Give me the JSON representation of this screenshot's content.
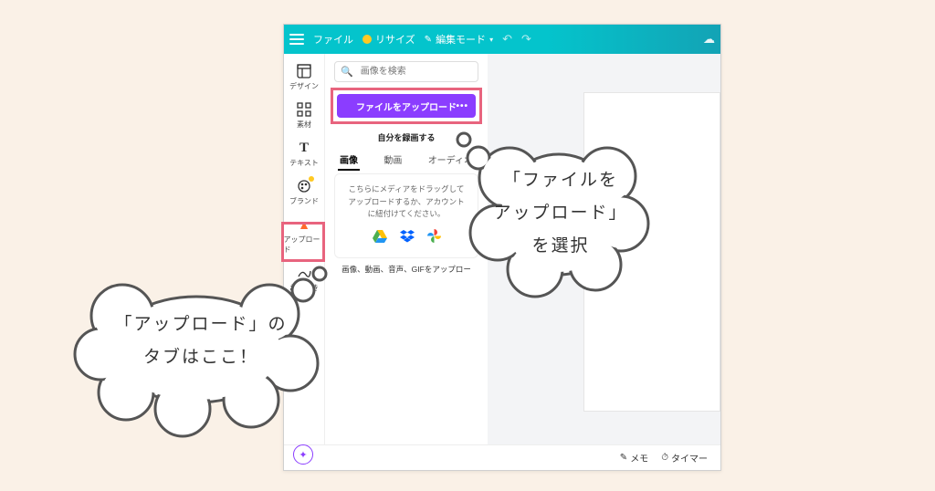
{
  "topbar": {
    "file_label": "ファイル",
    "resize_label": "リサイズ",
    "edit_mode_label": "編集モード"
  },
  "siderail": {
    "items": [
      {
        "label": "デザイン"
      },
      {
        "label": "素材"
      },
      {
        "label": "テキスト"
      },
      {
        "label": "ブランド"
      },
      {
        "label": "アップロード"
      },
      {
        "label": "お絵描き"
      }
    ]
  },
  "panel": {
    "search_placeholder": "画像を検索",
    "upload_button": "ファイルをアップロード",
    "record_self": "自分を録画する",
    "tabs": {
      "image": "画像",
      "video": "動画",
      "audio": "オーディオ"
    },
    "drag_line1": "こちらにメディアをドラッグして",
    "drag_line2": "アップロードするか、アカウント",
    "drag_line3": "に紐付けてください。",
    "caption": "画像、動画、音声、GIFをアップロー"
  },
  "bottombar": {
    "memo": "メモ",
    "timer": "タイマー"
  },
  "annotations": {
    "bubble1_l1": "「ファイルを",
    "bubble1_l2": "アップロード」",
    "bubble1_l3": "を選択",
    "bubble2_l1": "「アップロード」の",
    "bubble2_l2": "タブはここ！"
  }
}
